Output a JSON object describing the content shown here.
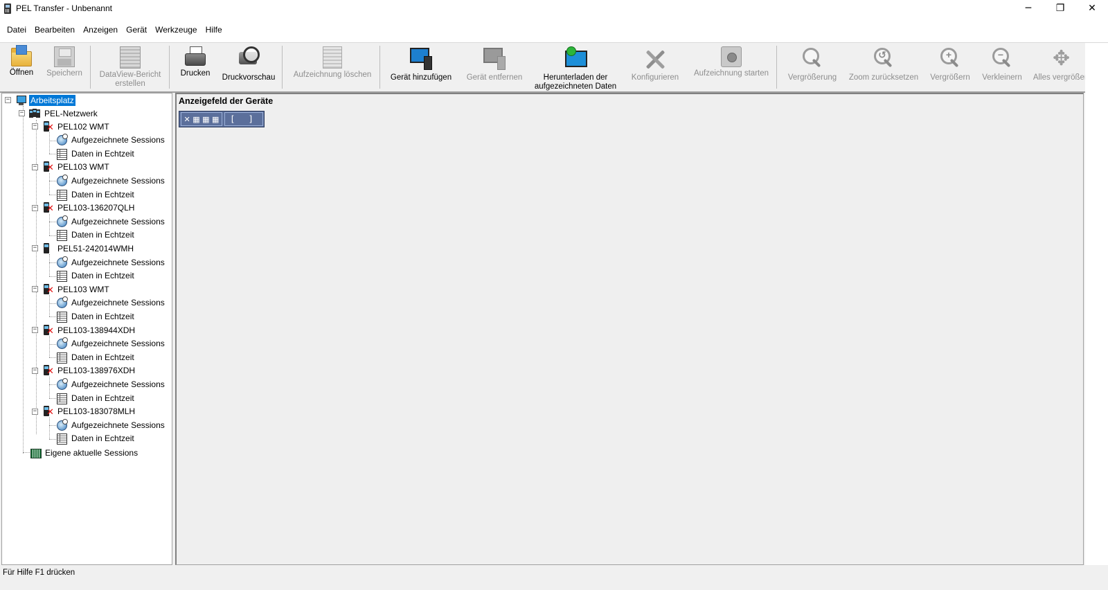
{
  "window": {
    "title": "PEL Transfer - Unbenannt",
    "controls": {
      "minimize": "─",
      "maximize": "❐",
      "close": "✕"
    }
  },
  "menu": [
    "Datei",
    "Bearbeiten",
    "Anzeigen",
    "Gerät",
    "Werkzeuge",
    "Hilfe"
  ],
  "toolbar": {
    "overflow": "»",
    "buttons": [
      {
        "label": "Öffnen",
        "icon": "folder-open-icon",
        "enabled": true
      },
      {
        "label": "Speichern",
        "icon": "save-disk-icon",
        "enabled": false
      },
      {
        "label": "DataView-Bericht erstellen",
        "icon": "report-icon",
        "enabled": false
      },
      {
        "label": "Drucken",
        "icon": "printer-icon",
        "enabled": true
      },
      {
        "label": "Druckvorschau",
        "icon": "print-preview-icon",
        "enabled": true
      },
      {
        "label": "Aufzeichnung löschen",
        "icon": "erase-recording-icon",
        "enabled": false
      },
      {
        "label": "Gerät hinzufügen",
        "icon": "add-device-icon",
        "enabled": true
      },
      {
        "label": "Gerät entfernen",
        "icon": "remove-device-icon",
        "enabled": false
      },
      {
        "label": "Herunterladen der aufgezeichneten Daten",
        "icon": "download-data-icon",
        "enabled": true
      },
      {
        "label": "Konfigurieren",
        "icon": "configure-tools-icon",
        "enabled": false
      },
      {
        "label": "Aufzeichnung starten",
        "icon": "start-recording-icon",
        "enabled": false
      },
      {
        "label": "Vergrößerung",
        "icon": "magnifier-icon",
        "enabled": false
      },
      {
        "label": "Zoom zurücksetzen",
        "icon": "zoom-reset-icon",
        "enabled": false
      },
      {
        "label": "Vergrößern",
        "icon": "zoom-in-icon",
        "enabled": false
      },
      {
        "label": "Verkleinern",
        "icon": "zoom-out-icon",
        "enabled": false
      },
      {
        "label": "Alles vergrößern",
        "icon": "zoom-all-icon",
        "enabled": false
      }
    ]
  },
  "tree": {
    "root": "Arbeitsplatz",
    "network": "PEL-Netzwerk",
    "devices": [
      {
        "name": "PEL102 WMT",
        "status": "disconnected"
      },
      {
        "name": "PEL103 WMT",
        "status": "disconnected"
      },
      {
        "name": "PEL103-136207QLH",
        "status": "disconnected"
      },
      {
        "name": "PEL51-242014WMH",
        "status": "ok"
      },
      {
        "name": "PEL103 WMT",
        "status": "disconnected"
      },
      {
        "name": "PEL103-138944XDH",
        "status": "disconnected"
      },
      {
        "name": "PEL103-138976XDH",
        "status": "disconnected"
      },
      {
        "name": "PEL103-183078MLH",
        "status": "disconnected"
      }
    ],
    "child_recorded": "Aufgezeichnete Sessions",
    "child_realtime": "Daten in Echtzeit",
    "own_sessions": "Eigene aktuelle Sessions",
    "expander": "−"
  },
  "main": {
    "title": "Anzeigefeld der Geräte",
    "mini_toolbar": {
      "tools": "✕ ▦ ▦ ▦",
      "fit": "[ ]"
    }
  },
  "status": {
    "text": "Für Hilfe F1 drücken"
  }
}
